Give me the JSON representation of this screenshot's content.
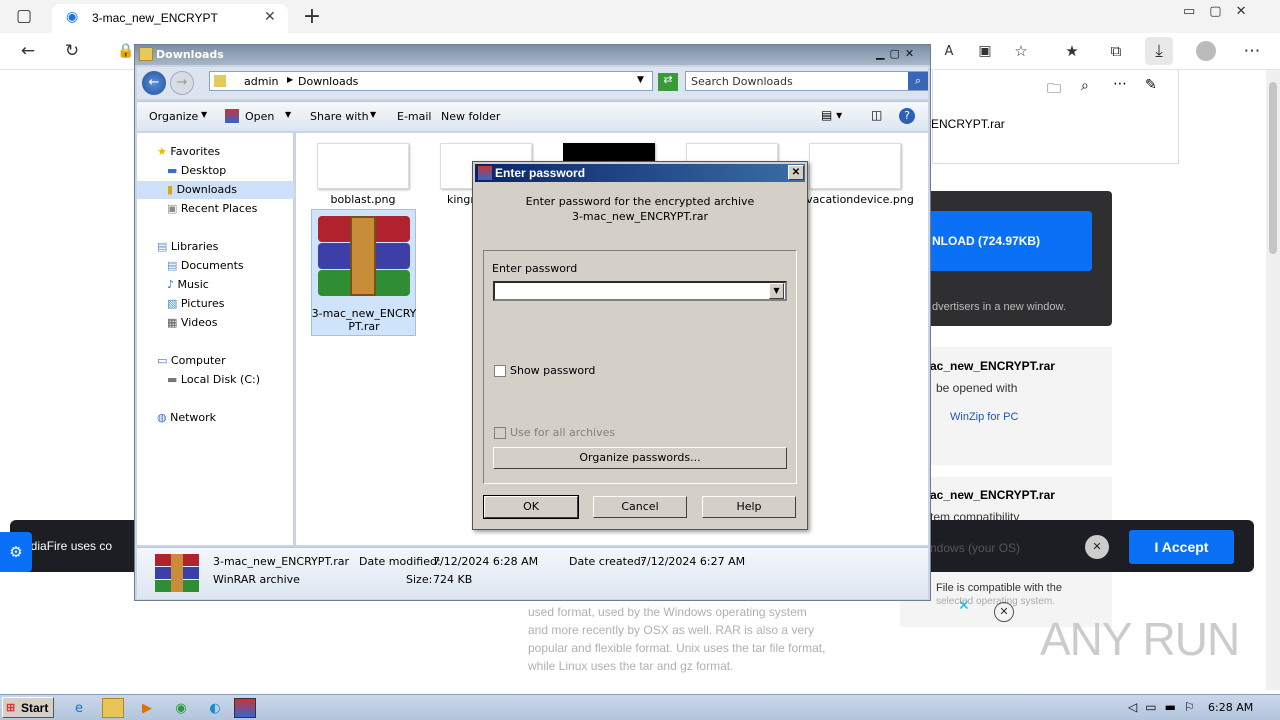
{
  "browser": {
    "tab_title": "3-mac_new_ENCRYPT",
    "downloads_filename": "ENCRYPT.rar"
  },
  "web": {
    "download_button": "NLOAD (724.97KB)",
    "advertisers_text": "dvertisers in a new window.",
    "file_title_1": "ac_new_ENCRYPT.rar",
    "opened_with": "be opened with",
    "winzip": "WinZip for PC",
    "file_title_2": "ac_new_ENCRYPT.rar",
    "compat": "tem compatibility",
    "compat_line": "ndows (your OS)",
    "file_compatible": "File is compatible with the",
    "selected_os": "selected operating system.",
    "cookie_text": "ediaFire uses co",
    "accept": "I Accept",
    "para": [
      "used format, used by the Windows operating system",
      "and more recently by OSX as well. RAR is also a very",
      "popular and flexible format. Unix uses the tar file format,",
      "while Linux uses the tar and gz format."
    ],
    "watermark": "ANY RUN"
  },
  "explorer": {
    "title": "Downloads",
    "breadcrumb": [
      "admin",
      "Downloads"
    ],
    "search_placeholder": "Search Downloads",
    "cmd": {
      "organize": "Organize",
      "open": "Open",
      "share": "Share with",
      "email": "E-mail",
      "new_folder": "New folder"
    },
    "nav": {
      "favorites": "Favorites",
      "desktop": "Desktop",
      "downloads": "Downloads",
      "recent": "Recent Places",
      "libraries": "Libraries",
      "documents": "Documents",
      "music": "Music",
      "pictures": "Pictures",
      "videos": "Videos",
      "computer": "Computer",
      "local_disk": "Local Disk (C:)",
      "network": "Network"
    },
    "files": {
      "f1": "boblast.png",
      "f2": "kingm",
      "f5": "vacationdevice.png",
      "rar_line1": "3-mac_new_ENCRY",
      "rar_line2": "PT.rar"
    },
    "details": {
      "name": "3-mac_new_ENCRYPT.rar",
      "type": "WinRAR archive",
      "modified_label": "Date modified:",
      "modified": "7/12/2024 6:28 AM",
      "size_label": "Size:",
      "size": "724 KB",
      "created_label": "Date created:",
      "created": "7/12/2024 6:27 AM"
    }
  },
  "dialog": {
    "title": "Enter password",
    "line1": "Enter password for the encrypted archive",
    "line2": "3-mac_new_ENCRYPT.rar",
    "field_label": "Enter password",
    "password_value": "",
    "show_password": "Show password",
    "use_all": "Use for all archives",
    "organize": "Organize passwords...",
    "ok": "OK",
    "cancel": "Cancel",
    "help": "Help"
  },
  "taskbar": {
    "start": "Start",
    "time": "6:28 AM"
  }
}
